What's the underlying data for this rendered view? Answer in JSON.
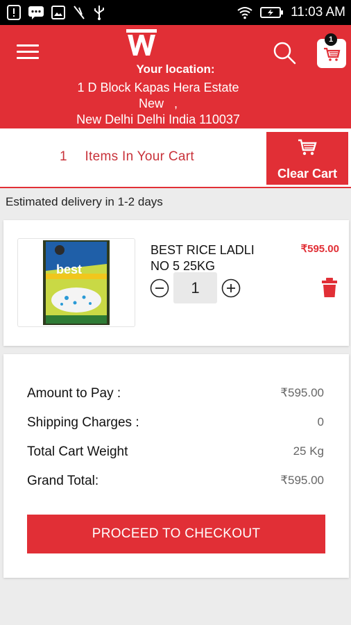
{
  "status_bar": {
    "time": "11:03 AM",
    "left_icons": [
      "alert-icon",
      "chat-icon",
      "image-icon",
      "no-sim-icon",
      "usb-icon"
    ],
    "right_icons": [
      "wifi-icon",
      "battery-icon"
    ]
  },
  "header": {
    "logo_icon": "brand-logo",
    "location_label": "Your location:",
    "location_line1": "1 D Block Kapas Hera Estate",
    "location_line2": "New   ,",
    "location_line3": "New Delhi Delhi India 110037",
    "cart_badge": "1",
    "accent": "#e12f36"
  },
  "cart_bar": {
    "count": "1",
    "items_label": "Items In Your Cart",
    "clear_label": "Clear Cart"
  },
  "delivery_text": "Estimated delivery in 1-2 days",
  "cart_item": {
    "name": "BEST RICE LADLI NO 5 25KG",
    "price": "₹595.00",
    "quantity": "1"
  },
  "summary": {
    "rows": [
      {
        "label": "Amount to Pay :",
        "value": "₹595.00"
      },
      {
        "label": "Shipping Charges :",
        "value": "0"
      },
      {
        "label": "Total Cart Weight",
        "value": "25 Kg"
      },
      {
        "label": "Grand Total:",
        "value": "₹595.00"
      }
    ],
    "checkout_label": "PROCEED TO CHECKOUT"
  }
}
